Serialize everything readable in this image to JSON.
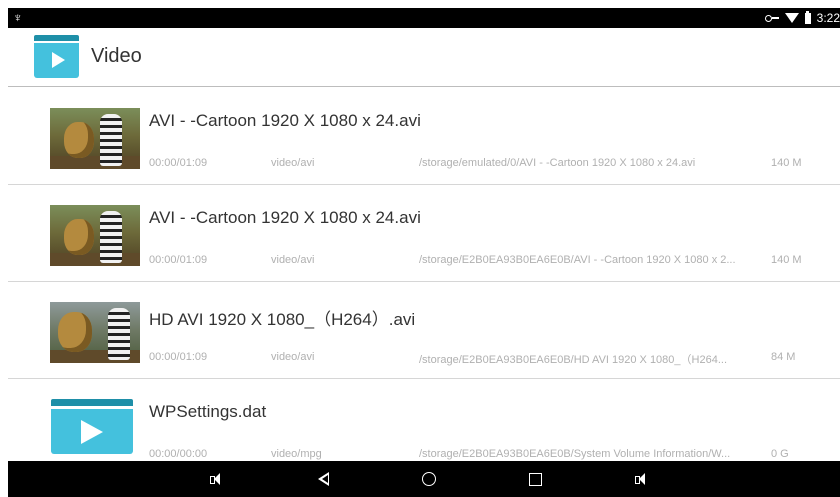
{
  "status_bar": {
    "usb_glyph": "♆",
    "time": "3:22"
  },
  "header": {
    "title": "Video"
  },
  "files": [
    {
      "name": "AVI -  -Cartoon 1920 X 1080 x 24.avi",
      "duration": "00:00/01:09",
      "mime": "video/avi",
      "path": "/storage/emulated/0/AVI -  -Cartoon 1920 X 1080 x 24.avi",
      "size": "140 M"
    },
    {
      "name": "AVI -  -Cartoon 1920 X 1080 x 24.avi",
      "duration": "00:00/01:09",
      "mime": "video/avi",
      "path": "/storage/E2B0EA93B0EA6E0B/AVI -  -Cartoon 1920 X 1080 x 2...",
      "size": "140 M"
    },
    {
      "name": "HD AVI   1920 X 1080_（H264）.avi",
      "duration": "00:00/01:09",
      "mime": "video/avi",
      "path": "/storage/E2B0EA93B0EA6E0B/HD AVI   1920 X 1080_（H264...",
      "size": "84 M"
    },
    {
      "name": "WPSettings.dat",
      "duration": "00:00/00:00",
      "mime": "video/mpg",
      "path": "/storage/E2B0EA93B0EA6E0B/System Volume Information/W...",
      "size": "0 G"
    }
  ],
  "colors": {
    "accent": "#44c1dd",
    "accent_dark": "#1e8fa8",
    "statusbar": "#000000",
    "meta_text": "#b0b0b0"
  }
}
